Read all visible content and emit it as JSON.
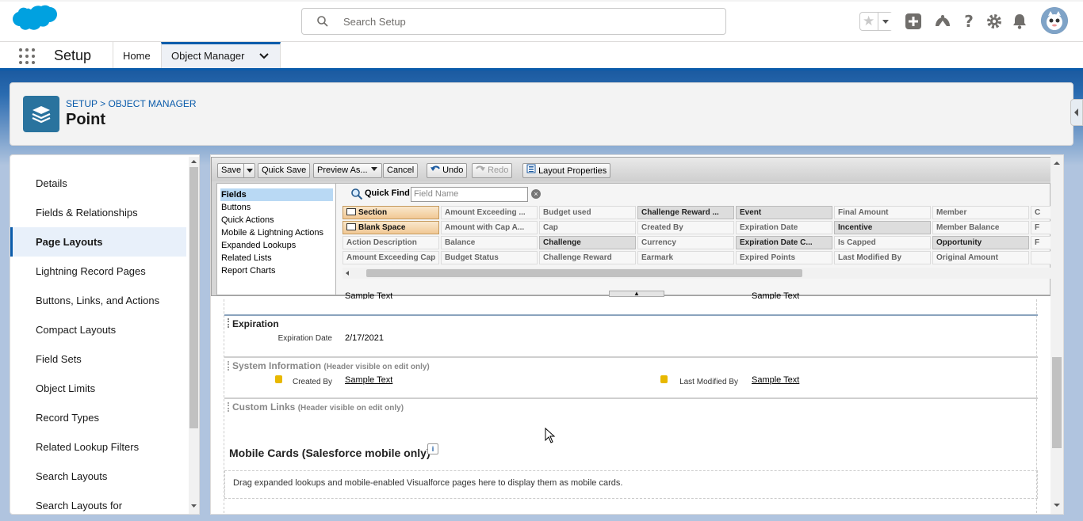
{
  "header": {
    "search_placeholder": "Search Setup",
    "icons": [
      "favorites-star-icon",
      "add-icon",
      "trailhead-icon",
      "help-icon",
      "gear-icon",
      "notification-bell-icon",
      "avatar-icon"
    ]
  },
  "nav": {
    "app_name": "Setup",
    "tabs": [
      {
        "label": "Home"
      },
      {
        "label": "Object Manager"
      }
    ]
  },
  "page": {
    "breadcrumb": "SETUP > OBJECT MANAGER",
    "title": "Point"
  },
  "sidebar": {
    "items": [
      {
        "label": "Details"
      },
      {
        "label": "Fields & Relationships"
      },
      {
        "label": "Page Layouts",
        "active": true
      },
      {
        "label": "Lightning Record Pages"
      },
      {
        "label": "Buttons, Links, and Actions"
      },
      {
        "label": "Compact Layouts"
      },
      {
        "label": "Field Sets"
      },
      {
        "label": "Object Limits"
      },
      {
        "label": "Record Types"
      },
      {
        "label": "Related Lookup Filters"
      },
      {
        "label": "Search Layouts"
      },
      {
        "label": "Search Layouts for"
      }
    ]
  },
  "toolbar": {
    "save": "Save",
    "quick_save": "Quick Save",
    "preview_as": "Preview As...",
    "cancel": "Cancel",
    "undo": "Undo",
    "redo": "Redo",
    "layout_properties": "Layout Properties"
  },
  "palette": {
    "categories": [
      "Fields",
      "Buttons",
      "Quick Actions",
      "Mobile & Lightning Actions",
      "Expanded Lookups",
      "Related Lists",
      "Report Charts"
    ],
    "quick_find_label": "Quick Find",
    "quick_find_placeholder": "Field Name",
    "fields": [
      [
        "Section",
        "Amount Exceeding ...",
        "Budget used",
        "Challenge Reward ...",
        "Event",
        "Final Amount",
        "Member",
        "C"
      ],
      [
        "Blank Space",
        "Amount with Cap A...",
        "Cap",
        "Created By",
        "Expiration Date",
        "Incentive",
        "Member Balance",
        "F"
      ],
      [
        "Action Description",
        "Balance",
        "Challenge",
        "Currency",
        "Expiration Date C...",
        "Is Capped",
        "Opportunity",
        "F"
      ],
      [
        "Amount Exceeding Cap",
        "Budget Status",
        "Challenge Reward",
        "Earmark",
        "Expired Points",
        "Last Modified By",
        "Original Amount",
        ""
      ]
    ]
  },
  "layout": {
    "partial_values": [
      "Sample Text",
      "Sample Text"
    ],
    "sections": {
      "expiration": {
        "title": "Expiration",
        "field_label": "Expiration Date",
        "field_value": "2/17/2021"
      },
      "system_info": {
        "title": "System Information",
        "note": "(Header visible on edit only)",
        "created_by_label": "Created By",
        "created_by_value": "Sample Text",
        "last_modified_label": "Last Modified By",
        "last_modified_value": "Sample Text"
      },
      "custom_links": {
        "title": "Custom Links",
        "note": "(Header visible on edit only)"
      }
    },
    "mobile_cards": {
      "title": "Mobile Cards (Salesforce mobile only)",
      "info": "i",
      "hint": "Drag expanded lookups and mobile-enabled Visualforce pages here to display them as mobile cards."
    }
  },
  "colors": {
    "brand": "#00a1e0",
    "accent": "#0b5cab",
    "object_icon": "#2a739e"
  }
}
